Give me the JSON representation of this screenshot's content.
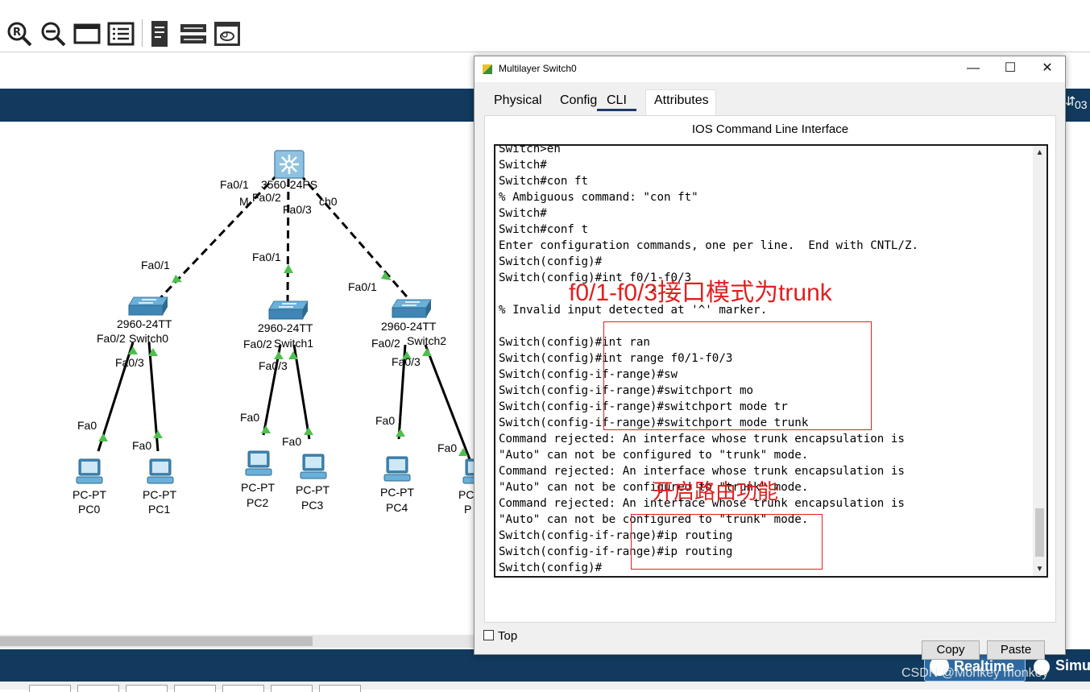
{
  "colors": {
    "app_band": "#113a5e",
    "link_green": "#4fbf4f",
    "annotation_red": "#e02020",
    "tab_underline": "#1f3a66"
  },
  "toolbar": {
    "icons": [
      "zoom-in-icon",
      "zoom-out-icon",
      "window-icon",
      "list-icon",
      "note-icon",
      "device-bar-icon",
      "cluster-icon"
    ]
  },
  "app": {
    "right_peek_text": "03",
    "realtime_label": "Realtime",
    "simulation_label": "Simu",
    "watermark": "CSDN @Monkey monkey"
  },
  "topology": {
    "core": {
      "port_left": "Fa0/1",
      "label_line1": "3560-24PS",
      "label_line2": "M",
      "port_mid": "Fa0/2",
      "label_tail": "ch0",
      "port_right": "Fa0/3"
    },
    "switches": [
      {
        "uplink": "Fa0/1",
        "model": "2960-24TT",
        "name": "Switch0",
        "port_a": "Fa0/2",
        "port_b": "Fa0/3"
      },
      {
        "uplink": "Fa0/1",
        "model": "2960-24TT",
        "name": "Switch1",
        "port_a": "Fa0/2",
        "port_b": "Fa0/3"
      },
      {
        "uplink": "Fa0/1",
        "model": "2960-24TT",
        "name": "Switch2",
        "port_a": "Fa0/2",
        "port_b": "Fa0/3"
      }
    ],
    "pcs": [
      {
        "port": "Fa0",
        "type": "PC-PT",
        "name": "PC0"
      },
      {
        "port": "Fa0",
        "type": "PC-PT",
        "name": "PC1"
      },
      {
        "port": "Fa0",
        "type": "PC-PT",
        "name": "PC2"
      },
      {
        "port": "Fa0",
        "type": "PC-PT",
        "name": "PC3"
      },
      {
        "port": "Fa0",
        "type": "PC-PT",
        "name": "PC4"
      },
      {
        "port": "Fa0",
        "type": "PC",
        "name": "P"
      }
    ]
  },
  "window": {
    "title": "Multilayer Switch0",
    "minimize": "—",
    "maximize": "☐",
    "close": "✕",
    "tabs": [
      "Physical",
      "Config",
      "CLI",
      "Attributes"
    ],
    "active_tab": "CLI",
    "panel_title": "IOS Command Line Interface",
    "terminal_lines": [
      "Switch>en",
      "Switch#",
      "Switch#con ft",
      "% Ambiguous command: \"con ft\"",
      "Switch#",
      "Switch#conf t",
      "Enter configuration commands, one per line.  End with CNTL/Z.",
      "Switch(config)#",
      "Switch(config)#int f0/1-f0/3",
      "                      ^",
      "% Invalid input detected at '^' marker.",
      "",
      "Switch(config)#int ran",
      "Switch(config)#int range f0/1-f0/3",
      "Switch(config-if-range)#sw",
      "Switch(config-if-range)#switchport mo",
      "Switch(config-if-range)#switchport mode tr",
      "Switch(config-if-range)#switchport mode trunk",
      "Command rejected: An interface whose trunk encapsulation is",
      "\"Auto\" can not be configured to \"trunk\" mode.",
      "Command rejected: An interface whose trunk encapsulation is",
      "\"Auto\" can not be configured to \"trunk\" mode.",
      "Command rejected: An interface whose trunk encapsulation is",
      "\"Auto\" can not be configured to \"trunk\" mode.",
      "Switch(config-if-range)#ip routing",
      "Switch(config-if-range)#ip routing",
      "Switch(config)#"
    ],
    "copy_label": "Copy",
    "paste_label": "Paste",
    "top_checkbox_label": "Top",
    "top_checked": false
  },
  "annotations": {
    "trunk_note": "f0/1-f0/3接口模式为trunk",
    "routing_note": "开启路由功能"
  }
}
